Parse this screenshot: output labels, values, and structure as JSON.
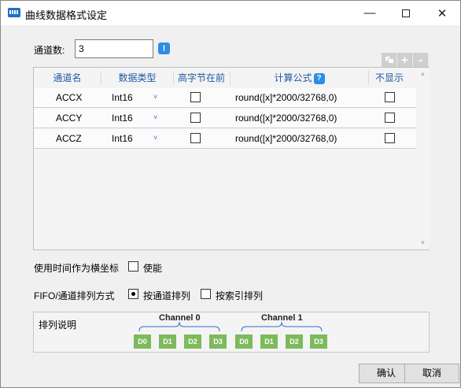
{
  "window": {
    "title": "曲线数据格式设定",
    "min_glyph": "—",
    "close_glyph": "✕"
  },
  "channels": {
    "label": "通道数:",
    "value": "3",
    "info_glyph": "!"
  },
  "toolbar": {
    "add_glyph": "+",
    "remove_glyph": "-"
  },
  "table": {
    "headers": {
      "name": "通道名",
      "type": "数据类型",
      "high_byte_first": "高字节在前",
      "formula": "计算公式",
      "formula_help": "?",
      "hide": "不显示"
    },
    "rows": [
      {
        "name": "ACCX",
        "type": "Int16",
        "formula": "round([x]*2000/32768,0)",
        "high_byte_first": false,
        "hide": false
      },
      {
        "name": "ACCY",
        "type": "Int16",
        "formula": "round([x]*2000/32768,0)",
        "high_byte_first": false,
        "hide": false
      },
      {
        "name": "ACCZ",
        "type": "Int16",
        "formula": "round([x]*2000/32768,0)",
        "high_byte_first": false,
        "hide": false
      }
    ],
    "type_chevron": "˅"
  },
  "time_axis": {
    "label": "使用时间作为横坐标",
    "enable_label": "使能",
    "enabled": false
  },
  "fifo": {
    "label": "FIFO/通道排列方式",
    "by_channel_label": "按通道排列",
    "by_index_label": "按索引排列",
    "selected": "by_channel"
  },
  "description": {
    "title": "排列说明",
    "groups": [
      {
        "label": "Channel 0",
        "blocks": [
          "D0",
          "D1",
          "D2",
          "D3"
        ]
      },
      {
        "label": "Channel 1",
        "blocks": [
          "D0",
          "D1",
          "D2",
          "D3"
        ]
      }
    ],
    "block_color": "#7dba5c"
  },
  "buttons": {
    "ok": "确认",
    "cancel": "取消"
  },
  "colors": {
    "header_text": "#1e5aa3",
    "info_badge": "#2b8ee6",
    "accent_blue": "#1e6fc4"
  }
}
